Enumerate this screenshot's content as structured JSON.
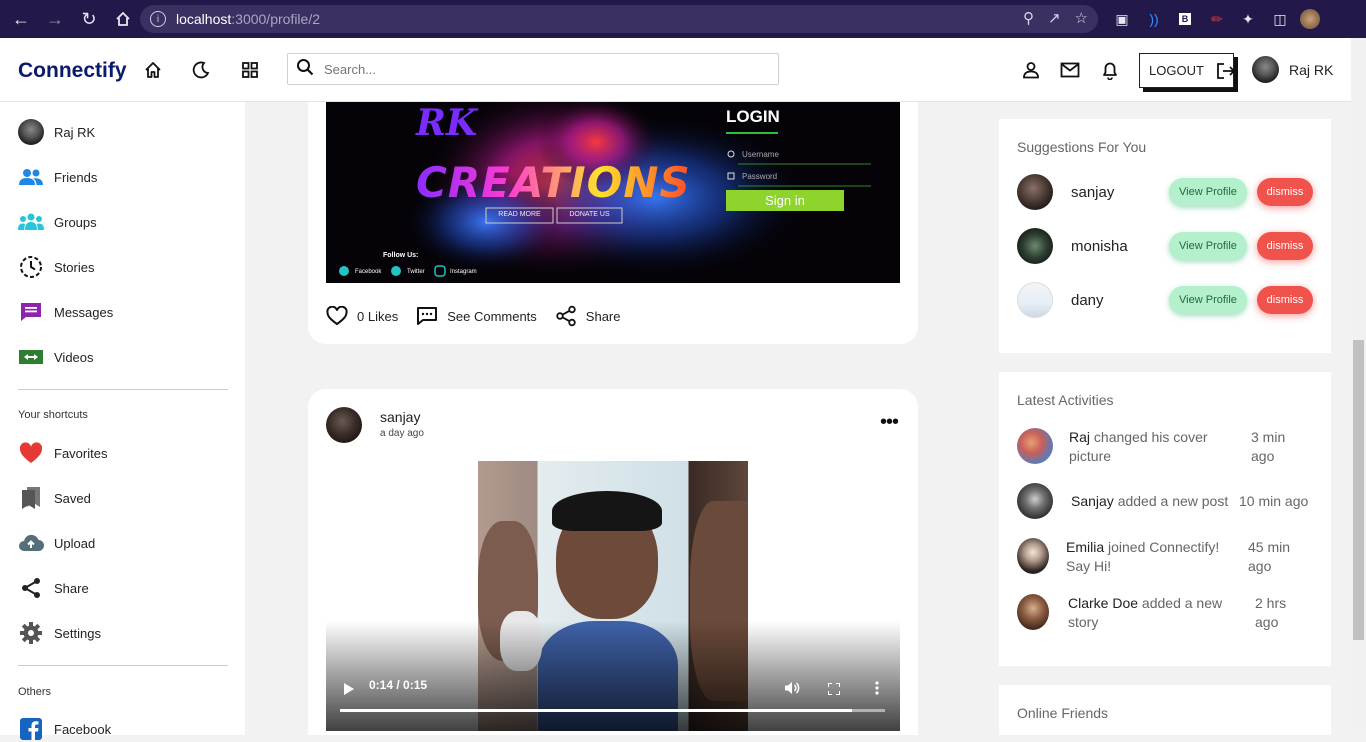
{
  "browser": {
    "url_host": "localhost",
    "url_path": ":3000/profile/2"
  },
  "header": {
    "logo": "Connectify",
    "search_placeholder": "Search...",
    "logout_label": "LOGOUT",
    "user_name": "Raj RK"
  },
  "sidebar": {
    "items": [
      {
        "label": "Raj RK",
        "icon": "user-avatar"
      },
      {
        "label": "Friends",
        "icon": "friends-icon",
        "color": "#1e88e5"
      },
      {
        "label": "Groups",
        "icon": "groups-icon",
        "color": "#26c6da"
      },
      {
        "label": "Stories",
        "icon": "stories-icon",
        "color": "#111111"
      },
      {
        "label": "Messages",
        "icon": "messages-icon",
        "color": "#8e24aa"
      },
      {
        "label": "Videos",
        "icon": "videos-icon",
        "color": "#2e7d32"
      }
    ],
    "shortcuts_title": "Your shortcuts",
    "shortcuts": [
      {
        "label": "Favorites",
        "icon": "heart-icon",
        "color": "#e53935"
      },
      {
        "label": "Saved",
        "icon": "saved-icon",
        "color": "#555555"
      },
      {
        "label": "Upload",
        "icon": "upload-icon",
        "color": "#546e7a"
      },
      {
        "label": "Share",
        "icon": "share-icon",
        "color": "#222222"
      },
      {
        "label": "Settings",
        "icon": "settings-icon",
        "color": "#555555"
      }
    ],
    "others_title": "Others",
    "others": [
      {
        "label": "Facebook",
        "icon": "facebook-icon",
        "color": "#1565c0"
      }
    ]
  },
  "post1": {
    "banner": {
      "rk": "RK",
      "creations": "CREATIONS",
      "read_more": "READ MORE",
      "donate": "DONATE US",
      "login": "LOGIN",
      "username": "Username",
      "password": "Password",
      "sign_in": "Sign in",
      "follow_us": "Follow Us:",
      "facebook": "Facebook",
      "twitter": "Twitter",
      "instagram": "Instagram"
    },
    "likes": "0 Likes",
    "comments": "See Comments",
    "share": "Share"
  },
  "post2": {
    "user": "sanjay",
    "time": "a day ago",
    "video": {
      "time": "0:14 / 0:15",
      "progress": 0.94
    }
  },
  "suggestions": {
    "title": "Suggestions For You",
    "people": [
      {
        "name": "sanjay",
        "view": "View Profile",
        "dismiss": "dismiss"
      },
      {
        "name": "monisha",
        "view": "View Profile",
        "dismiss": "dismiss"
      },
      {
        "name": "dany",
        "view": "View Profile",
        "dismiss": "dismiss"
      }
    ]
  },
  "activities": {
    "title": "Latest Activities",
    "items": [
      {
        "name": "Raj",
        "line1": " changed his cover",
        "line2": "picture",
        "time1": "3 min",
        "time2": "ago"
      },
      {
        "name": "Sanjay",
        "line1": " added a new post",
        "line2": "",
        "time1": "10 min ago",
        "time2": ""
      },
      {
        "name": "Emilia",
        "line1": " joined Connectify!",
        "line2": "Say Hi!",
        "time1": "45 min",
        "time2": "ago"
      },
      {
        "name": "Clarke Doe",
        "line1": " added a new",
        "line2": "story",
        "time1": "2 hrs",
        "time2": "ago"
      }
    ]
  },
  "online": {
    "title": "Online Friends"
  }
}
